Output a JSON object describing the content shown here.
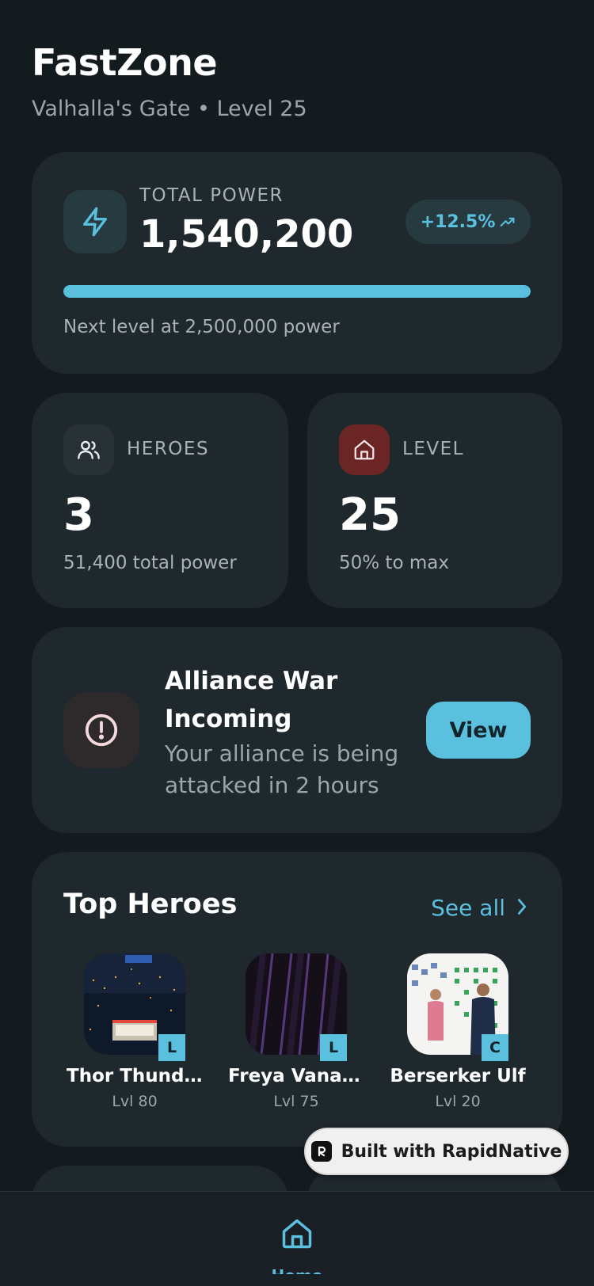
{
  "header": {
    "title": "FastZone",
    "subtitle": "Valhalla's Gate • Level 25"
  },
  "power": {
    "label": "TOTAL POWER",
    "value": "1,540,200",
    "change": "+12.5%",
    "progress_fraction": 1.0,
    "note": "Next level at 2,500,000 power",
    "icon": "lightning-icon",
    "accent": "#5bc0de"
  },
  "stats": {
    "heroes": {
      "label": "HEROES",
      "value": "3",
      "sub": "51,400 total power",
      "icon": "users-icon"
    },
    "level": {
      "label": "LEVEL",
      "value": "25",
      "sub": "50% to max",
      "icon": "home-icon",
      "icon_bg": "#6b2525"
    }
  },
  "alert": {
    "title": "Alliance War Incoming",
    "text": "Your alliance is being attacked in 2 hours",
    "button": "View",
    "icon": "alert-circle-icon"
  },
  "top_heroes": {
    "title": "Top Heroes",
    "see_all": "See all",
    "items": [
      {
        "name": "Thor Thunde...",
        "level": "Lvl 80",
        "rarity": "L"
      },
      {
        "name": "Freya Vanadis",
        "level": "Lvl 75",
        "rarity": "L"
      },
      {
        "name": "Berserker Ulf",
        "level": "Lvl 20",
        "rarity": "C"
      }
    ]
  },
  "built_with": "Built with RapidNative",
  "nav": {
    "home_label": "Home",
    "home_icon": "home-icon"
  }
}
